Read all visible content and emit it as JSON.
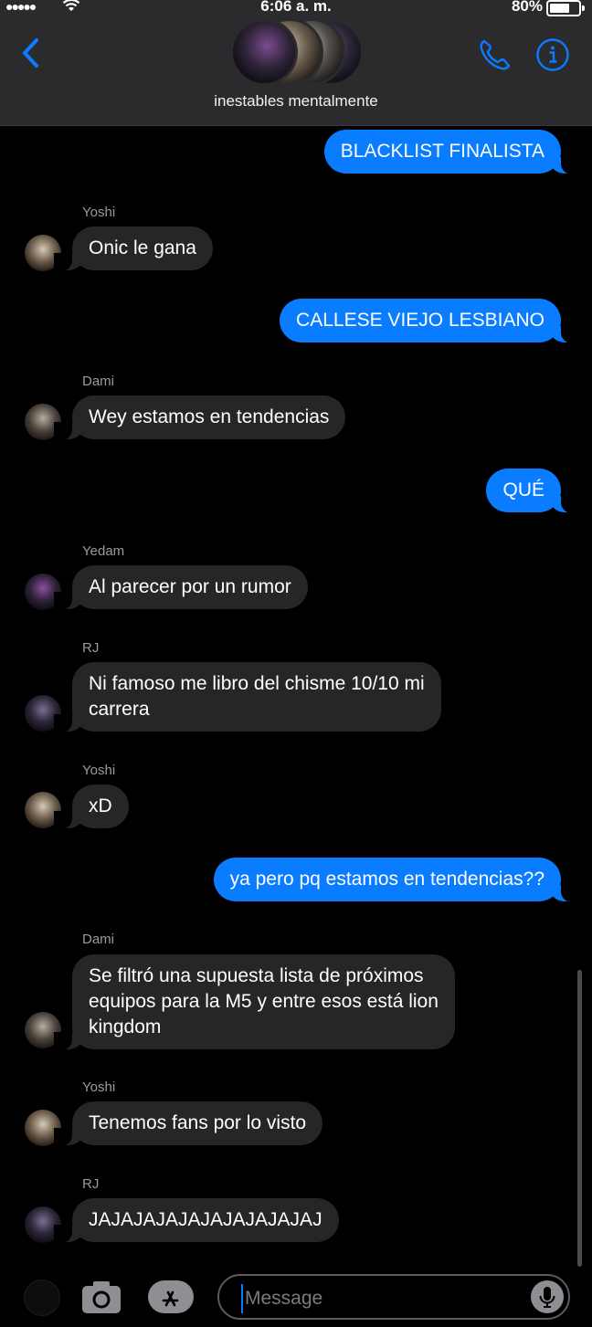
{
  "status_bar": {
    "signal": "●●●●●",
    "time": "6:06 a. m.",
    "battery_percent": "80%",
    "battery_level": 0.8
  },
  "header": {
    "group_name": "inestables mentalmente"
  },
  "messages": [
    {
      "type": "out",
      "text": "BLACKLIST FINALISTA"
    },
    {
      "type": "in",
      "sender": "Yoshi",
      "text": "Onic le gana"
    },
    {
      "type": "out",
      "text": "CALLESE VIEJO LESBIANO"
    },
    {
      "type": "in",
      "sender": "Dami",
      "text": "Wey estamos en tendencias"
    },
    {
      "type": "out",
      "text": "QUÉ"
    },
    {
      "type": "in",
      "sender": "Yedam",
      "text": "Al parecer por un rumor"
    },
    {
      "type": "in",
      "sender": "RJ",
      "text": "Ni famoso me libro del chisme 10/10 mi\ncarrera"
    },
    {
      "type": "in",
      "sender": "Yoshi",
      "text": "xD"
    },
    {
      "type": "out",
      "text": "ya pero pq estamos en tendencias??"
    },
    {
      "type": "in",
      "sender": "Dami",
      "text": "Se filtró una supuesta lista de próximos\nequipos para la M5 y entre esos está lion\nkingdom"
    },
    {
      "type": "in",
      "sender": "Yoshi",
      "text": "Tenemos fans por lo visto"
    },
    {
      "type": "in",
      "sender": "RJ",
      "text": "JAJAJAJAJAJAJAJAJAJAJ"
    }
  ],
  "input": {
    "placeholder": "Message"
  },
  "colors": {
    "accent": "#0a7cff",
    "incoming_bubble": "#262629",
    "header_bg": "#2b2b2d",
    "background": "#000000"
  },
  "icons": {
    "back": "chevron-left-icon",
    "call": "phone-icon",
    "info": "info-icon",
    "camera": "camera-icon",
    "apps": "app-store-icon",
    "mic": "microphone-icon"
  }
}
